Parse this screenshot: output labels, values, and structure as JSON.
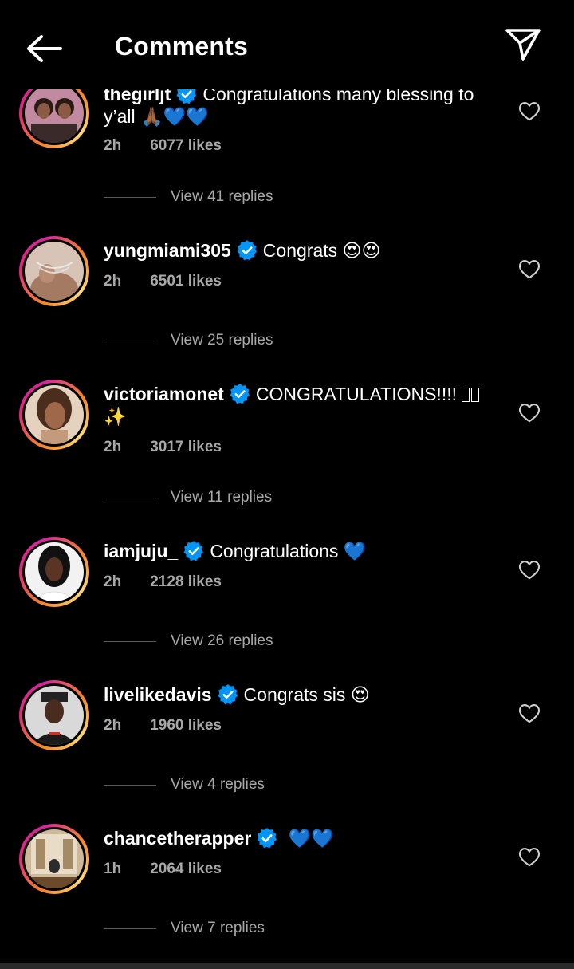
{
  "header": {
    "title": "Comments"
  },
  "comments": [
    {
      "username": "thegirljt",
      "text": "Congratulations many blessing to",
      "text2": "y’all 🙏🏾💙💙",
      "time": "2h",
      "likes": "6077 likes",
      "replies": "View 41 replies"
    },
    {
      "username": "yungmiami305",
      "text": "Congrats 😍😍",
      "time": "2h",
      "likes": "6501 likes",
      "replies": "View 25 replies"
    },
    {
      "username": "victoriamonet",
      "text": "CONGRATULATIONS!!!! ",
      "text2": "✨",
      "time": "2h",
      "likes": "3017 likes",
      "replies": "View 11 replies"
    },
    {
      "username": "iamjuju_",
      "text": "Congratulations 💙",
      "time": "2h",
      "likes": "2128 likes",
      "replies": "View 26 replies"
    },
    {
      "username": "livelikedavis",
      "text": "Congrats sis 😍",
      "time": "2h",
      "likes": "1960 likes",
      "replies": "View 4 replies"
    },
    {
      "username": "chancetherapper",
      "text": " 💙💙",
      "time": "1h",
      "likes": "2064 likes",
      "replies": "View 7 replies"
    }
  ],
  "colors": {
    "background": "#000000",
    "verified": "#0095f6",
    "muted": "#a8a8a8"
  }
}
